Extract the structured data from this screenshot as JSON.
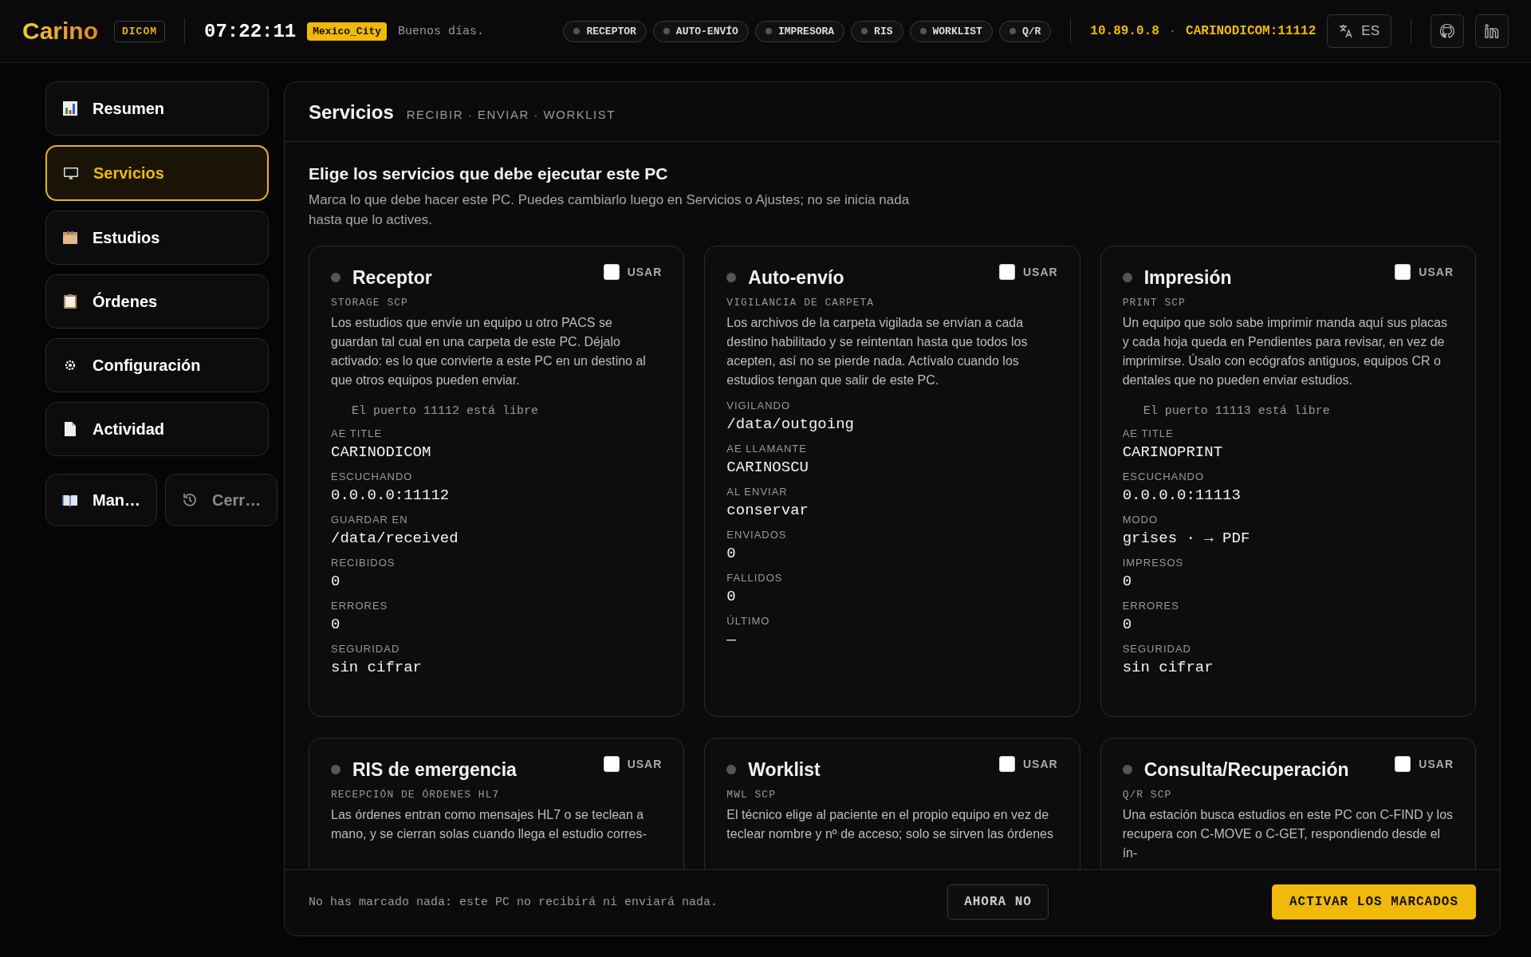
{
  "header": {
    "logo": "Carino",
    "logo_badge": "DICOM",
    "clock": "07:22:11",
    "timezone": "Mexico_City",
    "greeting": "Buenos días.",
    "services": [
      {
        "label": "RECEPTOR",
        "active": false
      },
      {
        "label": "AUTO-ENVÍO",
        "active": false
      },
      {
        "label": "IMPRESORA",
        "active": false
      },
      {
        "label": "RIS",
        "active": false
      },
      {
        "label": "WORKLIST",
        "active": false
      },
      {
        "label": "Q/R",
        "active": false
      }
    ],
    "ip": "10.89.0.8",
    "separator": "·",
    "ae_address": "CARINODICOM:11112",
    "language": "ES"
  },
  "sidebar": {
    "items": [
      {
        "label": "Resumen",
        "selected": false
      },
      {
        "label": "Servicios",
        "selected": true
      },
      {
        "label": "Estudios",
        "selected": false
      },
      {
        "label": "Órdenes",
        "selected": false
      },
      {
        "label": "Configuración",
        "selected": false
      },
      {
        "label": "Actividad",
        "selected": false
      }
    ],
    "bottom_buttons": [
      {
        "label": "Man…",
        "disabled": false
      },
      {
        "label": "Cerr…",
        "disabled": true
      }
    ]
  },
  "panel": {
    "title": "Servicios",
    "subtitle": "RECIBIR · ENVIAR · WORKLIST",
    "intro_title": "Elige los servicios que debe ejecutar este PC",
    "intro_text": "Marca lo que debe hacer este PC. Puedes cambiarlo luego en Servicios o Ajustes; no se inicia nada hasta que lo actives.",
    "cards": [
      {
        "title": "Receptor",
        "running": false,
        "use_label": "USAR",
        "checked": false,
        "protocol": "STORAGE SCP",
        "description": "Los estudios que envíe un equipo u otro PACS se guardan tal cual en una carpeta de este PC. Déjalo activado: es lo que convierte a este PC en un destino al que otros equipos pueden enviar.",
        "port_note": "El puerto 11112 está libre",
        "fields": [
          {
            "label": "AE TITLE",
            "value": "CARINODICOM"
          },
          {
            "label": "ESCUCHANDO",
            "value": "0.0.0.0:11112"
          },
          {
            "label": "GUARDAR EN",
            "value": "/data/received"
          },
          {
            "label": "RECIBIDOS",
            "value": "0"
          },
          {
            "label": "ERRORES",
            "value": "0"
          },
          {
            "label": "SEGURIDAD",
            "value": "sin cifrar"
          }
        ]
      },
      {
        "title": "Auto-envío",
        "running": false,
        "use_label": "USAR",
        "checked": false,
        "protocol": "VIGILANCIA DE CARPETA",
        "description": "Los archivos de la carpeta vigilada se envían a cada destino habilitado y se reintentan hasta que todos los acepten, así no se pierde nada. Actívalo cuando los estudios tengan que salir de este PC.",
        "fields": [
          {
            "label": "VIGILANDO",
            "value": "/data/outgoing"
          },
          {
            "label": "AE LLAMANTE",
            "value": "CARINOSCU"
          },
          {
            "label": "AL ENVIAR",
            "value": "conservar"
          },
          {
            "label": "ENVIADOS",
            "value": "0"
          },
          {
            "label": "FALLIDOS",
            "value": "0"
          },
          {
            "label": "ÚLTIMO",
            "value": "—"
          }
        ]
      },
      {
        "title": "Impresión",
        "running": false,
        "use_label": "USAR",
        "checked": false,
        "protocol": "PRINT SCP",
        "description": "Un equipo que solo sabe imprimir manda aquí sus placas y cada hoja queda en Pendientes para revisar, en vez de imprimirse. Úsalo con ecógrafos antiguos, equipos CR o dentales que no pueden enviar estudios.",
        "port_note": "El puerto 11113 está libre",
        "fields": [
          {
            "label": "AE TITLE",
            "value": "CARINOPRINT"
          },
          {
            "label": "ESCUCHANDO",
            "value": "0.0.0.0:11113"
          },
          {
            "label": "MODO",
            "value": "grises · → PDF"
          },
          {
            "label": "IMPRESOS",
            "value": "0"
          },
          {
            "label": "ERRORES",
            "value": "0"
          },
          {
            "label": "SEGURIDAD",
            "value": "sin cifrar"
          }
        ]
      },
      {
        "title": "RIS de emergencia",
        "running": false,
        "use_label": "USAR",
        "checked": false,
        "protocol": "RECEPCIÓN DE ÓRDENES HL7",
        "description": "Las órdenes entran como mensajes HL7 o se teclean a mano, y se cierran solas cuando llega el estudio corres-"
      },
      {
        "title": "Worklist",
        "running": false,
        "use_label": "USAR",
        "checked": false,
        "protocol": "MWL SCP",
        "description": "El técnico elige al paciente en el propio equipo en vez de teclear nombre y nº de acceso; solo se sirven las órdenes"
      },
      {
        "title": "Consulta/Recuperación",
        "running": false,
        "use_label": "USAR",
        "checked": false,
        "protocol": "Q/R SCP",
        "description": "Una estación busca estudios en este PC con C-FIND y los recupera con C-MOVE o C-GET, respondiendo desde el ín-"
      }
    ],
    "footer": {
      "message": "No has marcado nada: este PC no recibirá ni enviará nada.",
      "secondary_button": "AHORA NO",
      "primary_button": "ACTIVAR LOS MARCADOS"
    }
  }
}
